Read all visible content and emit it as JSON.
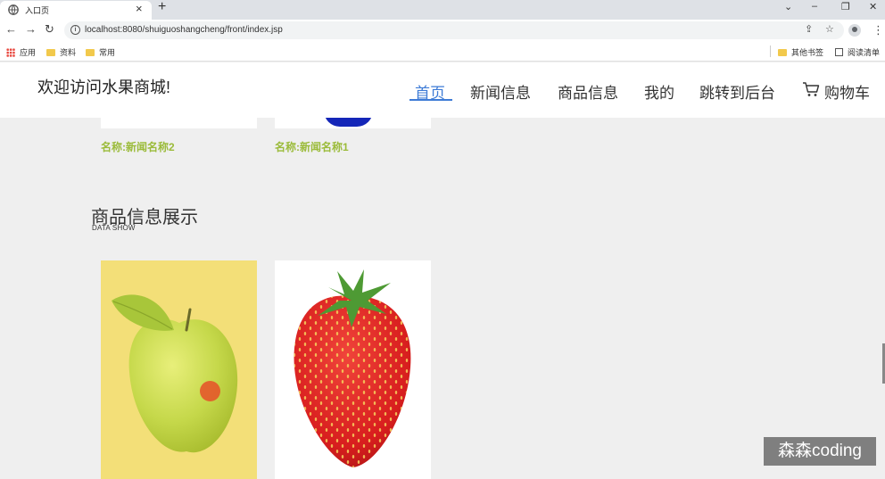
{
  "browser": {
    "tab_title": "入口页",
    "url": "localhost:8080/shuiguoshangcheng/front/index.jsp",
    "bookmarks": {
      "apps": "应用",
      "folder1": "资料",
      "folder2": "常用",
      "other": "其他书签",
      "reading_list": "阅读清单"
    }
  },
  "site": {
    "title": "欢迎访问水果商城!",
    "nav": {
      "home": "首页",
      "news": "新闻信息",
      "products": "商品信息",
      "mine": "我的",
      "admin": "跳转到后台",
      "cart": "购物车"
    }
  },
  "news": {
    "items": [
      {
        "name": "名称:新闻名称2"
      },
      {
        "name": "名称:新闻名称1"
      }
    ]
  },
  "products_section": {
    "title": "商品信息展示",
    "subtitle": "DATA SHOW"
  },
  "watermark": "森森coding",
  "colors": {
    "accent": "#3e7bd6",
    "news_name": "#9bbb3a",
    "page_bg": "#efefef"
  }
}
